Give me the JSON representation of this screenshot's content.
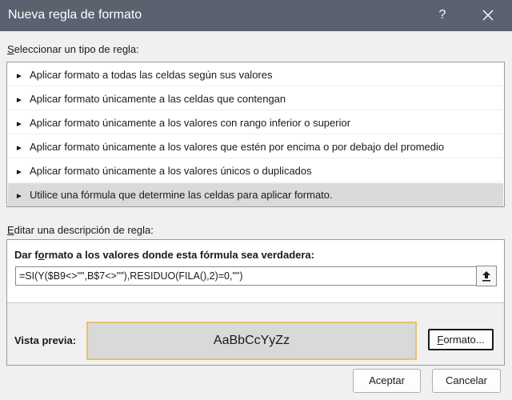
{
  "window": {
    "title": "Nueva regla de formato",
    "help_label": "?",
    "close_label": "Cerrar"
  },
  "rule_type": {
    "label": "Seleccionar un tipo de regla:",
    "items": [
      {
        "label": "Aplicar formato a todas las celdas según sus valores",
        "selected": false
      },
      {
        "label": "Aplicar formato únicamente a las celdas que contengan",
        "selected": false
      },
      {
        "label": "Aplicar formato únicamente a los valores con rango inferior o superior",
        "selected": false
      },
      {
        "label": "Aplicar formato únicamente a los valores que estén por encima o por debajo del promedio",
        "selected": false
      },
      {
        "label": "Aplicar formato únicamente a los valores únicos o duplicados",
        "selected": false
      },
      {
        "label": "Utilice una fórmula que determine las celdas para aplicar formato.",
        "selected": true
      }
    ]
  },
  "description": {
    "label": "Editar una descripción de regla:",
    "heading": "Dar formato a los valores donde esta fórmula sea verdadera:",
    "formula": "=SI(Y($B9<>\"\",B$7<>\"\"),RESIDUO(FILA(),2)=0,\"\")",
    "preview_label": "Vista previa:",
    "preview_text": "AaBbCcYyZz",
    "format_button": "Formato..."
  },
  "buttons": {
    "ok": "Aceptar",
    "cancel": "Cancelar"
  },
  "colors": {
    "titlebar": "#5a6270",
    "selected_row": "#dadada",
    "preview_bg": "#d9d9d9",
    "preview_border": "#e4c36b"
  }
}
